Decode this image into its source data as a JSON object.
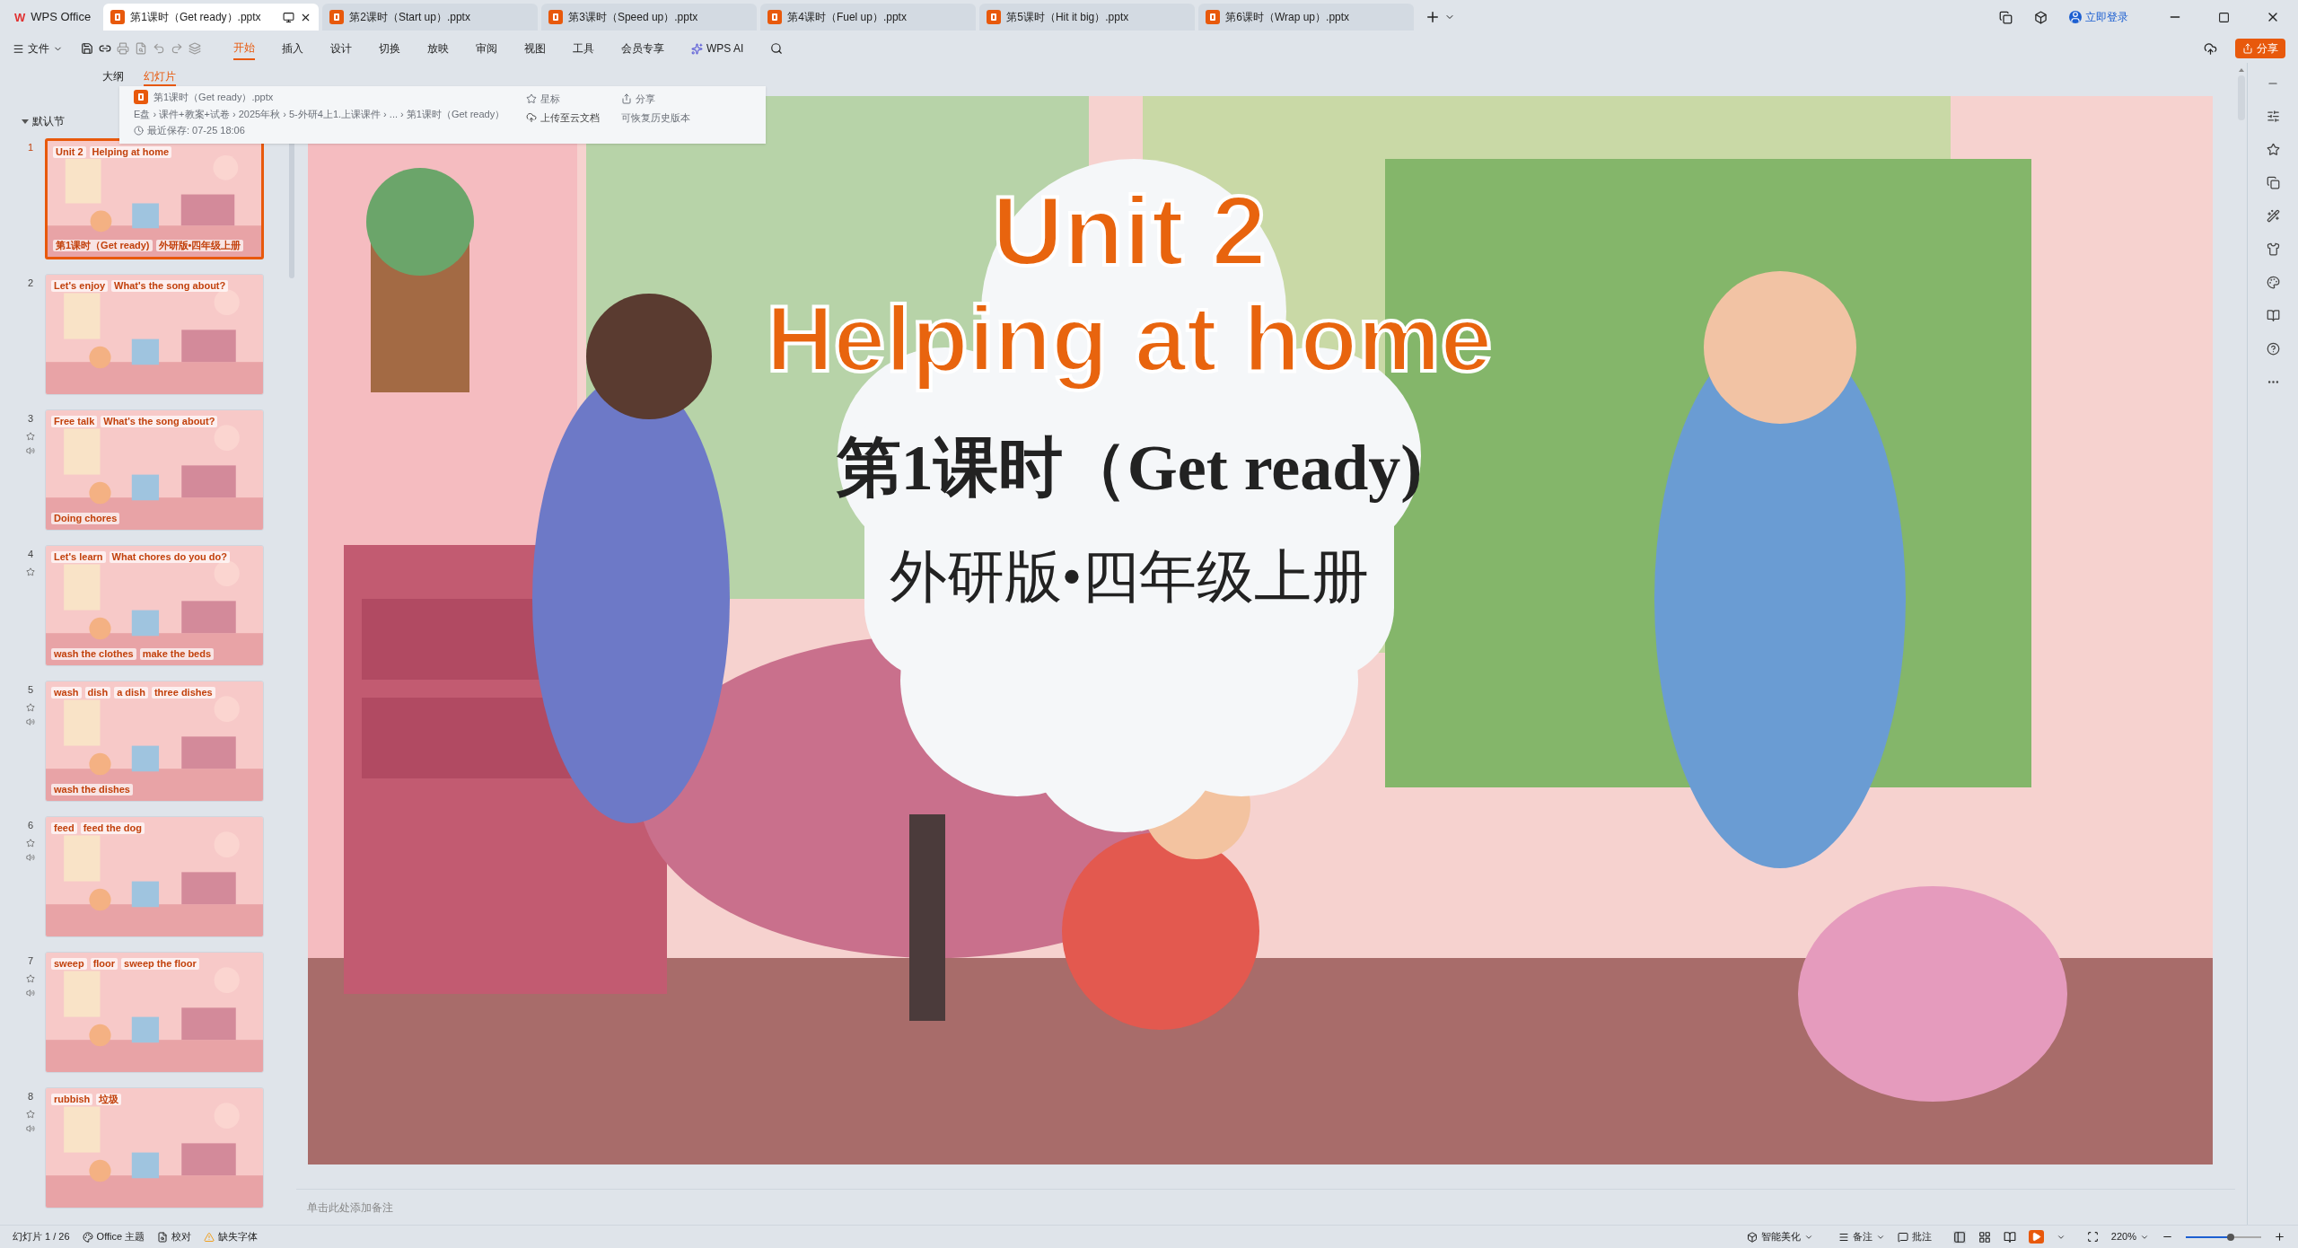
{
  "app": "WPS Office",
  "logo": "W",
  "tabs": [
    {
      "label": "第1课时（Get ready）.pptx",
      "selected": true
    },
    {
      "label": "第2课时（Start up）.pptx",
      "selected": false
    },
    {
      "label": "第3课时（Speed up）.pptx",
      "selected": false
    },
    {
      "label": "第4课时（Fuel up）.pptx",
      "selected": false
    },
    {
      "label": "第5课时（Hit it big）.pptx",
      "selected": false
    },
    {
      "label": "第6课时（Wrap up）.pptx",
      "selected": false
    }
  ],
  "login": "立即登录",
  "file_menu": "文件",
  "menu": [
    {
      "label": "开始",
      "selected": true
    },
    {
      "label": "插入",
      "selected": false
    },
    {
      "label": "设计",
      "selected": false
    },
    {
      "label": "切换",
      "selected": false
    },
    {
      "label": "放映",
      "selected": false
    },
    {
      "label": "审阅",
      "selected": false
    },
    {
      "label": "视图",
      "selected": false
    },
    {
      "label": "工具",
      "selected": false
    },
    {
      "label": "会员专享",
      "selected": false
    }
  ],
  "ai": "WPS AI",
  "share": "分享",
  "panel_tabs": [
    {
      "label": "大纲",
      "selected": false
    },
    {
      "label": "幻灯片",
      "selected": true
    }
  ],
  "section": "默认节",
  "slides": [
    {
      "number": "1",
      "selected": true,
      "animation": false,
      "audio": false,
      "texts": [
        "Unit 2",
        "Helping at home",
        "第1课时（Get ready)",
        "外研版•四年级上册"
      ]
    },
    {
      "number": "2",
      "selected": false,
      "animation": false,
      "audio": false,
      "texts": [
        "Let's enjoy",
        "What's the song about?"
      ]
    },
    {
      "number": "3",
      "selected": false,
      "animation": true,
      "audio": true,
      "texts": [
        "Free talk",
        "What's the song about?",
        "Doing chores"
      ]
    },
    {
      "number": "4",
      "selected": false,
      "animation": true,
      "audio": false,
      "texts": [
        "Let's learn",
        "What chores do you do?",
        "wash the clothes",
        "make the beds"
      ]
    },
    {
      "number": "5",
      "selected": false,
      "animation": true,
      "audio": true,
      "texts": [
        "wash",
        "dish",
        "a dish",
        "three dishes",
        "wash the dishes"
      ]
    },
    {
      "number": "6",
      "selected": false,
      "animation": true,
      "audio": true,
      "texts": [
        "feed",
        "feed the dog"
      ]
    },
    {
      "number": "7",
      "selected": false,
      "animation": true,
      "audio": true,
      "texts": [
        "sweep",
        "floor",
        "sweep the floor"
      ]
    },
    {
      "number": "8",
      "selected": false,
      "animation": true,
      "audio": true,
      "texts": [
        "rubbish",
        "垃圾"
      ]
    }
  ],
  "popup": {
    "file": "第1课时（Get ready）.pptx",
    "path": "E盘 › 课件+教案+试卷 › 2025年秋 › 5-外研4上1.上课课件 › ... › 第1课时（Get ready）",
    "saved": "最近保存: 07-25 18:06",
    "star": "星标",
    "upload": "上传至云文档",
    "share": "分享",
    "history": "可恢复历史版本"
  },
  "slide": {
    "unit": "Unit 2",
    "title": "Helping at home",
    "lesson": "第1课时（Get ready)",
    "edition": "外研版•四年级上册"
  },
  "notes_placeholder": "单击此处添加备注",
  "status": {
    "slide_count": "幻灯片 1 / 26",
    "theme": "Office 主题",
    "proofing": "校对",
    "missing_fonts": "缺失字体",
    "beautify": "智能美化",
    "notes": "备注",
    "comments": "批注",
    "zoom": "220%",
    "level": 0.6
  }
}
